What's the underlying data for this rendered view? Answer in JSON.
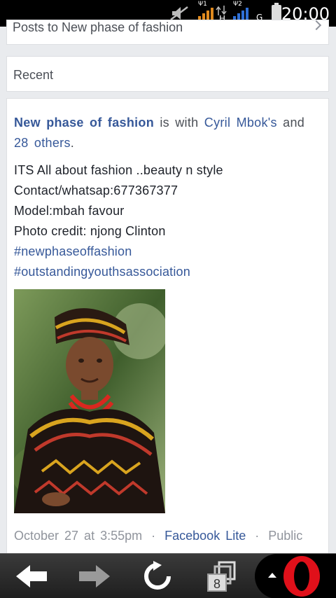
{
  "status_bar": {
    "time": "20:00",
    "sim1_label": "Ψ1",
    "sim1_network": "H",
    "sim2_label": "Ψ2",
    "sim2_network": "G",
    "icons": [
      "mute-icon",
      "signal-icon",
      "data-arrows-icon",
      "signal-icon",
      "battery-icon"
    ],
    "colors": {
      "signal1": "#e08a1e",
      "signal2": "#2f6fd6"
    }
  },
  "top_card": {
    "posts_to_label": "Posts to New phase of fashion"
  },
  "recent": {
    "label": "Recent"
  },
  "post": {
    "page_name": "New phase of fashion",
    "is_with_text": "is with",
    "tagged_person": "Cyril Mbok's",
    "and_text": "and",
    "others_text": "28 others",
    "period": ".",
    "body_lines": [
      "ITS All about fashion ..beauty  n style",
      "Contact/whatsap:677367377",
      "Model:mbah  favour",
      "Photo credit:  njong Clinton"
    ],
    "hashtags": [
      "#newphaseoffashion",
      "#outstandingyouthsassociation"
    ],
    "photo_description_icon": "post-photo",
    "timestamp": "October 27 at 3:55pm",
    "separator": "·",
    "via_app": "Facebook Lite",
    "privacy": "Public"
  },
  "nav_bar": {
    "tab_count": "8",
    "icons": [
      "back-arrow-icon",
      "forward-arrow-icon",
      "reload-icon",
      "tabs-icon",
      "opera-logo-icon"
    ],
    "colors": {
      "opera_red": "#e0101a",
      "back_arrow": "#ffffff",
      "forward_arrow": "#9a9a9a"
    }
  }
}
